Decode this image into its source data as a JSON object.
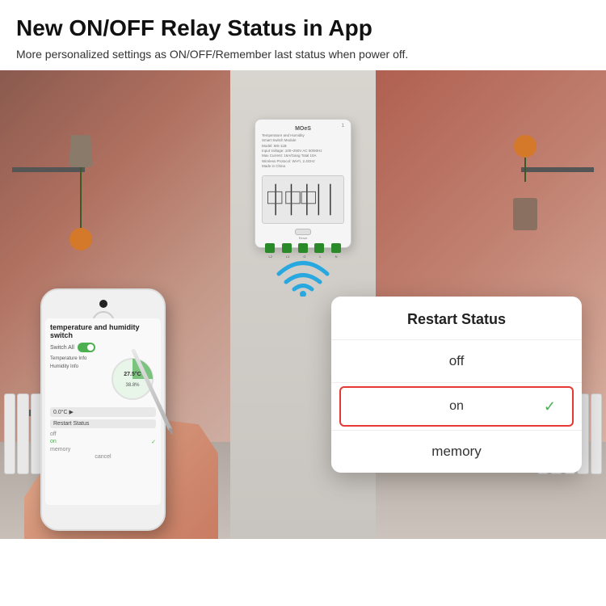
{
  "header": {
    "title": "New ON/OFF Relay Status in App",
    "subtitle": "More personalized settings as ON/OFF/Remember last status when power off."
  },
  "device": {
    "brand": "MOeS",
    "model_line1": "Temperature and Humidity",
    "model_line2": "Smart Switch Module",
    "model_line3": "Model: MS-11B",
    "model_line4": "Input Voltage: 100~250V AC 50/60Hz",
    "model_line5": "Max Current: 16A/Gang Total 10A",
    "model_line6": "Wireless Protocol: Wi-Fi, 2.4GHz",
    "model_line7": "Made in China",
    "number": "1",
    "reset_label": "Reset",
    "terminals": [
      "L2",
      "L1",
      "G",
      "L",
      "N"
    ]
  },
  "phone": {
    "app_title": "temperature and humidity switch",
    "switch_all_label": "Switch All",
    "temperature_label": "Temperature",
    "temperature_value": "27.5°C",
    "humidity_label": "Humidity",
    "humidity_value": "38.8%",
    "restart_status_label": "Restart Status",
    "options": [
      "off",
      "on",
      "memory"
    ],
    "selected_option": "on",
    "cancel_label": "cancel"
  },
  "popup": {
    "title": "Restart Status",
    "option_off": "off",
    "option_on": "on",
    "option_memory": "memory",
    "selected": "on",
    "check_icon": "✓"
  },
  "colors": {
    "toggle_on": "#4CAF50",
    "selected_border": "#e53935",
    "check_color": "#4CAF50",
    "wifi_color": "#29a8e0",
    "accent_text": "#222"
  }
}
